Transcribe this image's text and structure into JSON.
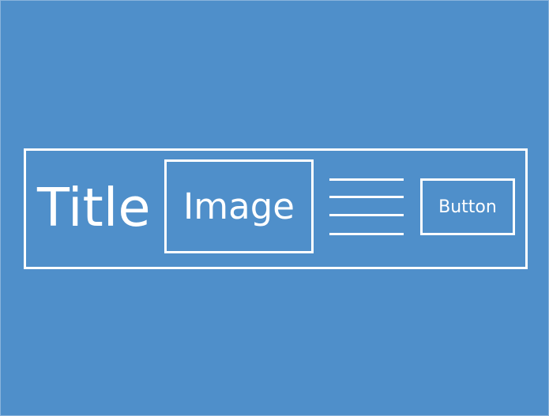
{
  "title": "Title",
  "image_label": "Image",
  "button_label": "Button",
  "colors": {
    "background": "#4f8fca",
    "foreground": "#ffffff"
  }
}
